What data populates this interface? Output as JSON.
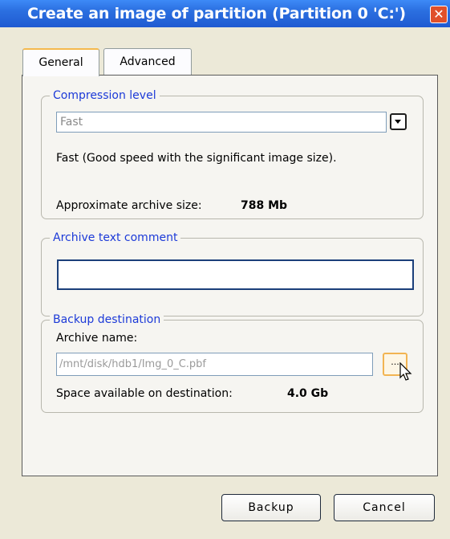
{
  "window": {
    "title": "Create an image of partition (Partition 0 'C:')"
  },
  "tabs": [
    {
      "label": "General"
    },
    {
      "label": "Advanced"
    }
  ],
  "compression": {
    "legend": "Compression level",
    "selected": "Fast",
    "description": "Fast (Good speed with the significant image size).",
    "size_label": "Approximate archive size:",
    "size_value": "788 Mb"
  },
  "comment": {
    "legend": "Archive text comment",
    "value": ""
  },
  "destination": {
    "legend": "Backup destination",
    "name_label": "Archive name:",
    "path": "/mnt/disk/hdb1/Img_0_C.pbf",
    "browse_label": "...",
    "space_label": "Space available on destination:",
    "space_value": "4.0 Gb"
  },
  "buttons": {
    "backup": "Backup",
    "cancel": "Cancel"
  },
  "colors": {
    "titlebar": "#2b6fe0",
    "legend_text": "#1c3ad8",
    "close": "#e0502a",
    "active_tab_accent": "#f5b94d"
  }
}
